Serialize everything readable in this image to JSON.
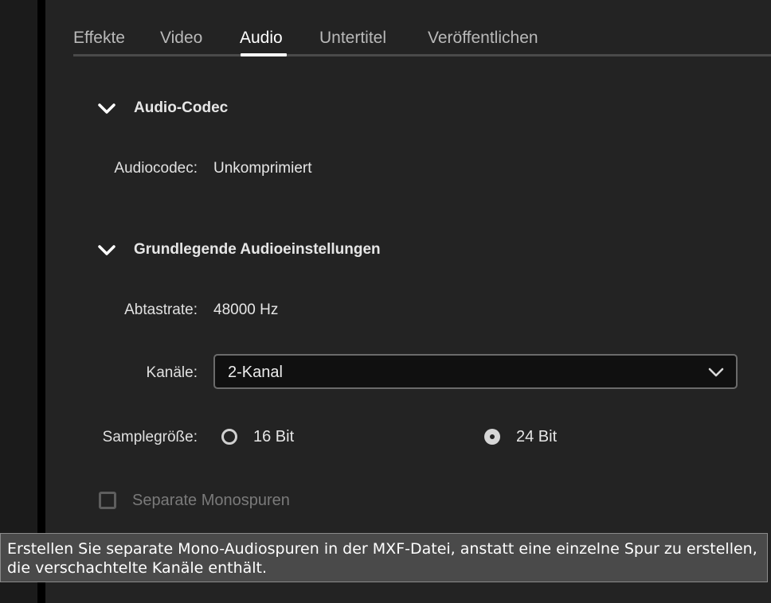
{
  "tabs": [
    {
      "label": "Effekte",
      "active": false
    },
    {
      "label": "Video",
      "active": false
    },
    {
      "label": "Audio",
      "active": true
    },
    {
      "label": "Untertitel",
      "active": false
    },
    {
      "label": "Veröffentlichen",
      "active": false
    }
  ],
  "audio_codec_section": {
    "title": "Audio-Codec",
    "codec_label": "Audiocodec:",
    "codec_value": "Unkomprimiert"
  },
  "basic_audio_section": {
    "title": "Grundlegende Audioeinstellungen",
    "sample_rate_label": "Abtastrate:",
    "sample_rate_value": "48000 Hz",
    "channels_label": "Kanäle:",
    "channels_value": "2-Kanal",
    "sample_size_label": "Samplegröße:",
    "sample_size_options": [
      {
        "label": "16 Bit",
        "checked": false
      },
      {
        "label": "24 Bit",
        "checked": true
      }
    ],
    "mono_tracks_label": "Separate Monospuren",
    "mono_tracks_checked": false,
    "mono_tracks_enabled": false
  },
  "tooltip": {
    "text": "Erstellen Sie separate Mono-Audiospuren in der MXF-Datei, anstatt eine einzelne Spur zu erstellen, die verschachtelte Kanäle enthält."
  },
  "colors": {
    "background": "#232323",
    "tooltip_background": "#4a4a4a",
    "active_tab": "#ffffff",
    "inactive_tab": "#b9b9b9"
  },
  "icons": {
    "section_toggle": "chevron-down-icon",
    "select_arrow": "chevron-down-icon"
  }
}
